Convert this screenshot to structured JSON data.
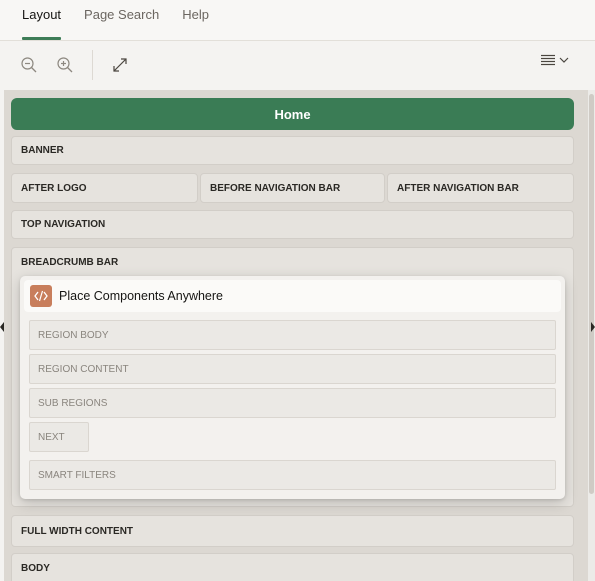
{
  "tabs": [
    {
      "label": "Layout",
      "active": true
    },
    {
      "label": "Page Search",
      "active": false
    },
    {
      "label": "Help",
      "active": false
    }
  ],
  "toolbar": {
    "icons": [
      "zoom-out-icon",
      "zoom-in-icon",
      "expand-icon",
      "menu-icon",
      "chevron-down-icon"
    ]
  },
  "layout": {
    "page_title": "Home",
    "banner": "BANNER",
    "after_logo": "AFTER LOGO",
    "before_navigation_bar": "BEFORE NAVIGATION BAR",
    "after_navigation_bar": "AFTER NAVIGATION BAR",
    "top_navigation": "TOP NAVIGATION",
    "breadcrumb_bar": "BREADCRUMB BAR",
    "full_width_content": "FULL WIDTH CONTENT",
    "body": "BODY"
  },
  "panel": {
    "title": "Place Components Anywhere",
    "icon": "code-icon",
    "items": {
      "region_body": "REGION BODY",
      "region_content": "REGION CONTENT",
      "sub_regions": "SUB REGIONS",
      "next": "NEXT",
      "smart_filters": "SMART FILTERS"
    }
  },
  "colors": {
    "accent": "#3a7c55",
    "icon_bg": "#c87e5c",
    "canvas": "#dcd8d2"
  }
}
